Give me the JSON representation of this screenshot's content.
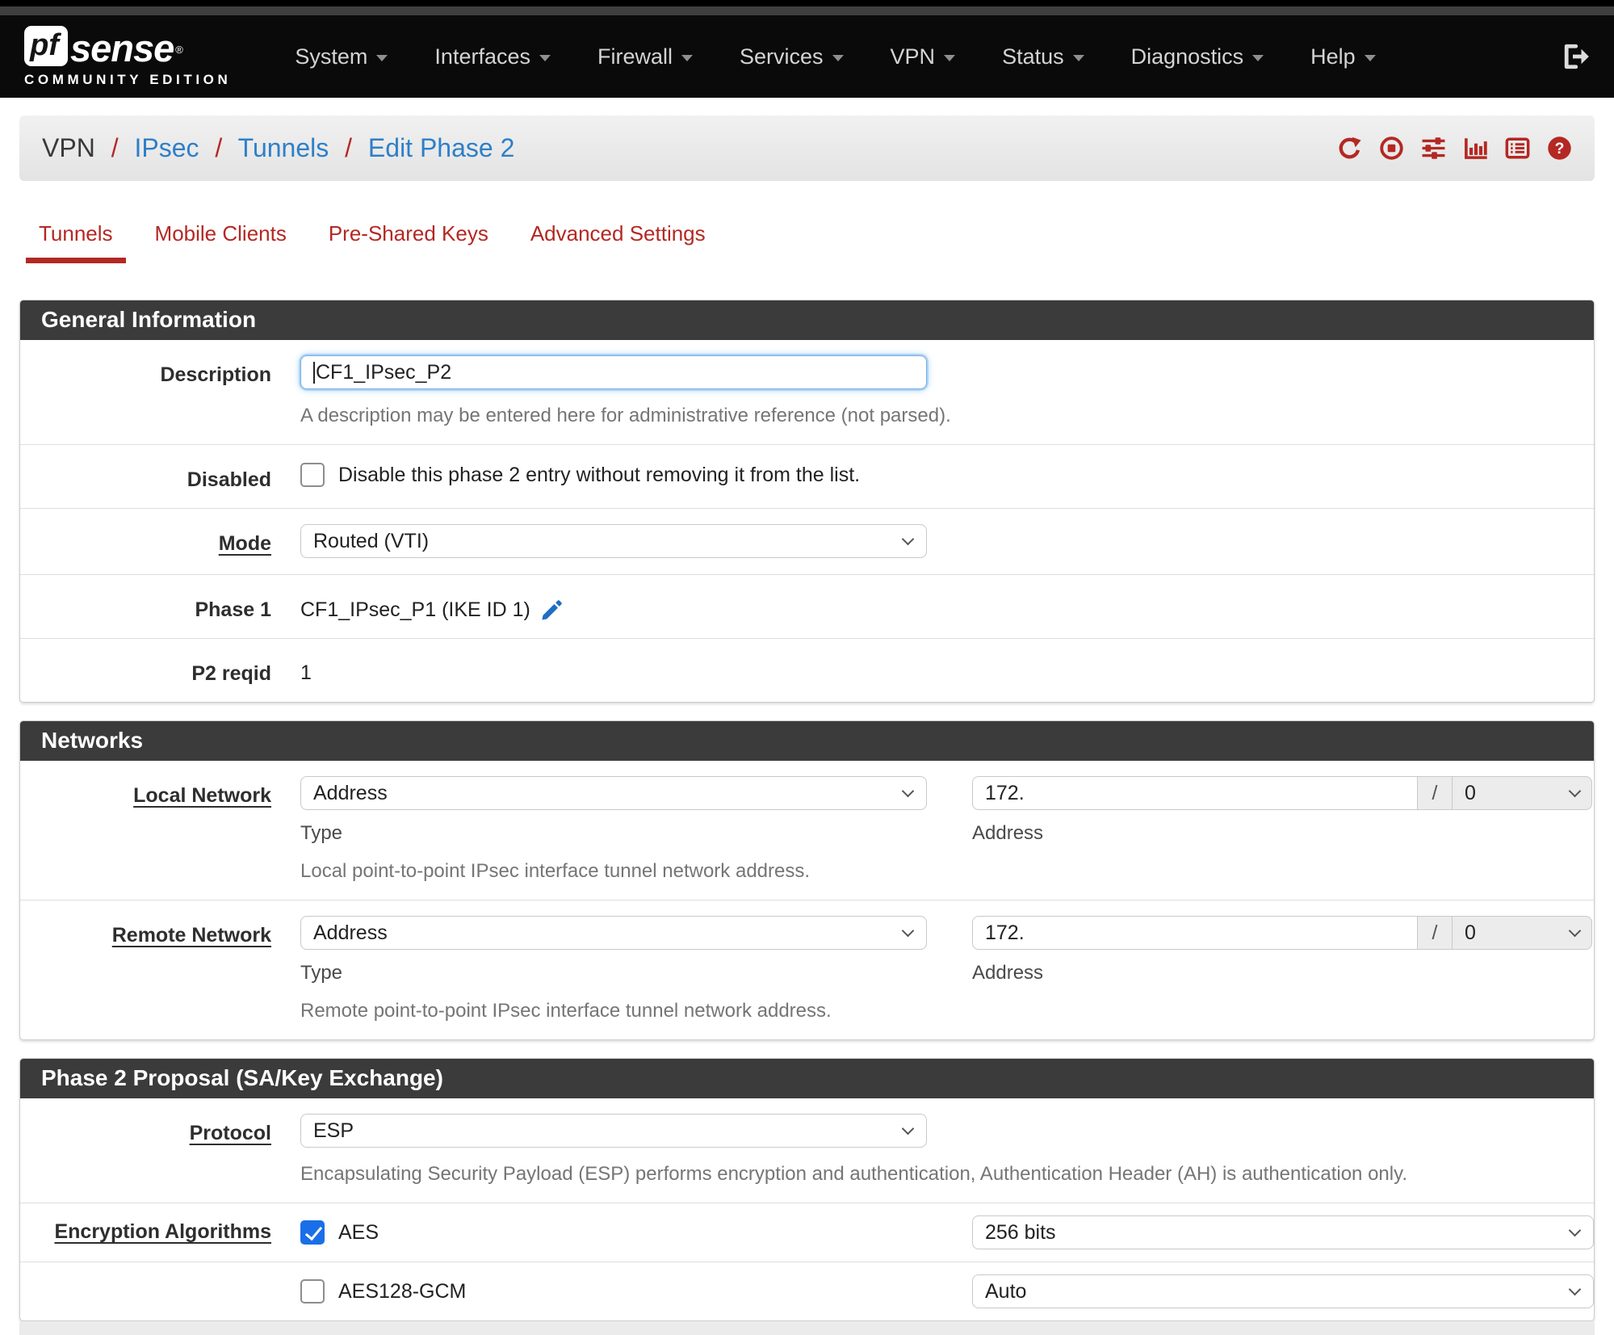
{
  "colors": {
    "accent_red": "#b42823",
    "link_blue": "#2e7fc8",
    "checkbox_blue": "#1a6fe8"
  },
  "navbar": {
    "brand": {
      "box_text": "pf",
      "name": "sense",
      "registered": "®",
      "subtitle": "COMMUNITY EDITION"
    },
    "items": [
      {
        "label": "System"
      },
      {
        "label": "Interfaces"
      },
      {
        "label": "Firewall"
      },
      {
        "label": "Services"
      },
      {
        "label": "VPN"
      },
      {
        "label": "Status"
      },
      {
        "label": "Diagnostics"
      },
      {
        "label": "Help"
      }
    ],
    "logout_icon": "sign-out-icon"
  },
  "breadcrumb": {
    "separator": "/",
    "items": [
      "VPN",
      "IPsec",
      "Tunnels",
      "Edit Phase 2"
    ],
    "icons": [
      "refresh-icon",
      "stop-circle-icon",
      "sliders-icon",
      "bar-chart-icon",
      "list-icon",
      "help-icon"
    ]
  },
  "tabs": [
    {
      "label": "Tunnels",
      "active": true
    },
    {
      "label": "Mobile Clients",
      "active": false
    },
    {
      "label": "Pre-Shared Keys",
      "active": false
    },
    {
      "label": "Advanced Settings",
      "active": false
    }
  ],
  "general": {
    "title": "General Information",
    "description_label": "Description",
    "description_value": "CF1_IPsec_P2",
    "description_help": "A description may be entered here for administrative reference (not parsed).",
    "disabled_label": "Disabled",
    "disabled_checkbox_label": "Disable this phase 2 entry without removing it from the list.",
    "disabled_checked": false,
    "mode_label": "Mode",
    "mode_value": "Routed (VTI)",
    "phase1_label": "Phase 1",
    "phase1_value": "CF1_IPsec_P1 (IKE ID 1)",
    "p2reqid_label": "P2 reqid",
    "p2reqid_value": "1"
  },
  "networks": {
    "title": "Networks",
    "type_caption": "Type",
    "address_caption": "Address",
    "slash": "/",
    "local": {
      "label": "Local Network",
      "type_value": "Address",
      "address_value": "172.",
      "mask_value": "0",
      "help": "Local point-to-point IPsec interface tunnel network address."
    },
    "remote": {
      "label": "Remote Network",
      "type_value": "Address",
      "address_value": "172.",
      "mask_value": "0",
      "help": "Remote point-to-point IPsec interface tunnel network address."
    }
  },
  "proposal": {
    "title": "Phase 2 Proposal (SA/Key Exchange)",
    "protocol_label": "Protocol",
    "protocol_value": "ESP",
    "protocol_help": "Encapsulating Security Payload (ESP) performs encryption and authentication, Authentication Header (AH) is authentication only.",
    "encryption_label": "Encryption Algorithms",
    "algorithms": [
      {
        "name": "AES",
        "checked": true,
        "key_length": "256 bits"
      },
      {
        "name": "AES128-GCM",
        "checked": false,
        "key_length": "Auto"
      }
    ]
  }
}
